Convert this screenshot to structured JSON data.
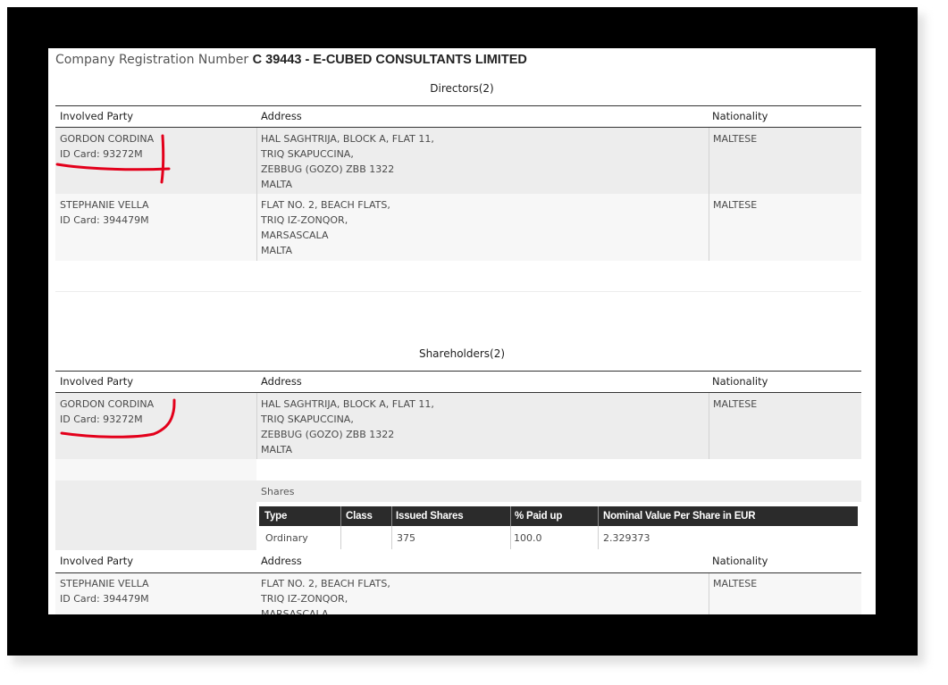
{
  "header": {
    "prefix": "Company Registration Number",
    "number_and_name": "C 39443 - E-CUBED CONSULTANTS LIMITED"
  },
  "directors": {
    "title": "Directors(2)",
    "columns": [
      "Involved Party",
      "Address",
      "Nationality"
    ],
    "rows": [
      {
        "name": "GORDON CORDINA",
        "id": "ID Card: 93272M",
        "address": [
          "HAL SAGHTRIJA, BLOCK A, FLAT 11,",
          "TRIQ SKAPUCCINA,",
          "ZEBBUG (GOZO) ZBB 1322",
          "MALTA"
        ],
        "nationality": "MALTESE"
      },
      {
        "name": "STEPHANIE VELLA",
        "id": "ID Card: 394479M",
        "address": [
          "FLAT NO. 2, BEACH FLATS,",
          "TRIQ IZ-ZONQOR,",
          "MARSASCALA",
          "MALTA"
        ],
        "nationality": "MALTESE"
      }
    ]
  },
  "shareholders": {
    "title": "Shareholders(2)",
    "columns": [
      "Involved Party",
      "Address",
      "Nationality"
    ],
    "rows": [
      {
        "name": "GORDON CORDINA",
        "id": "ID Card: 93272M",
        "address": [
          "HAL SAGHTRIJA, BLOCK A, FLAT 11,",
          "TRIQ SKAPUCCINA,",
          "ZEBBUG (GOZO) ZBB 1322",
          "MALTA"
        ],
        "nationality": "MALTESE",
        "shares_label": "Shares",
        "shares_columns": [
          "Type",
          "Class",
          "Issued Shares",
          "% Paid up",
          "Nominal Value Per Share in EUR"
        ],
        "shares_row": [
          "Ordinary",
          "",
          "375",
          "100.0",
          "2.329373"
        ]
      },
      {
        "name": "STEPHANIE VELLA",
        "id": "ID Card: 394479M",
        "address": [
          "FLAT NO. 2, BEACH FLATS,",
          "TRIQ IZ-ZONQOR,",
          "MARSASCALA"
        ],
        "nationality": "MALTESE"
      }
    ]
  },
  "colors": {
    "annotation": "#e3001b",
    "table_header_bg": "#2b2b2b",
    "row_band": "#ededed"
  }
}
